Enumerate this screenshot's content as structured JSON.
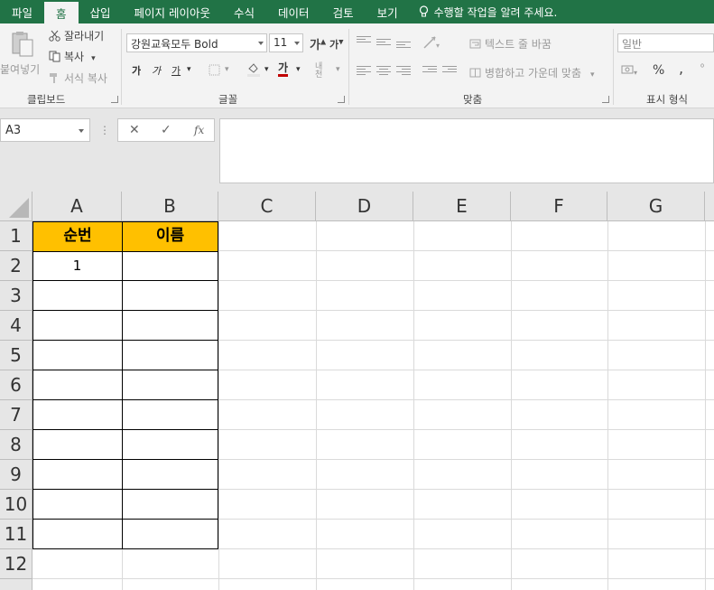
{
  "ribbon_tabs": [
    {
      "label": "파일",
      "active": false
    },
    {
      "label": "홈",
      "active": true
    },
    {
      "label": "삽입",
      "active": false
    },
    {
      "label": "페이지 레이아웃",
      "active": false
    },
    {
      "label": "수식",
      "active": false
    },
    {
      "label": "데이터",
      "active": false
    },
    {
      "label": "검토",
      "active": false
    },
    {
      "label": "보기",
      "active": false
    }
  ],
  "tell_me": "수행할 작업을 알려 주세요.",
  "clipboard": {
    "paste": "붙여넣기",
    "cut": "잘라내기",
    "copy": "복사",
    "format_painter": "서식 복사",
    "group_label": "클립보드"
  },
  "font": {
    "name": "강원교육모두 Bold",
    "size": "11",
    "bold": "가",
    "italic": "가",
    "underline": "가",
    "font_color": "가",
    "phonetic": "내천",
    "group_label": "글꼴"
  },
  "alignment": {
    "wrap_text": "텍스트 줄 바꿈",
    "merge_center": "병합하고 가운데 맞춤",
    "group_label": "맞춤"
  },
  "number": {
    "format": "일반",
    "percent": "%",
    "comma": ",",
    "group_label": "표시 형식"
  },
  "formula_bar": {
    "name_box": "A3",
    "cancel": "✕",
    "enter": "✓",
    "fx": "fx",
    "content": ""
  },
  "columns": [
    "A",
    "B",
    "C",
    "D",
    "E",
    "F",
    "G"
  ],
  "rows": [
    "1",
    "2",
    "3",
    "4",
    "5",
    "6",
    "7",
    "8",
    "9",
    "10",
    "11",
    "12"
  ],
  "table": {
    "header_a": "순번",
    "header_b": "이름",
    "a2": "1",
    "header_fill": "#ffc000"
  },
  "colors": {
    "excel_green": "#217346"
  }
}
